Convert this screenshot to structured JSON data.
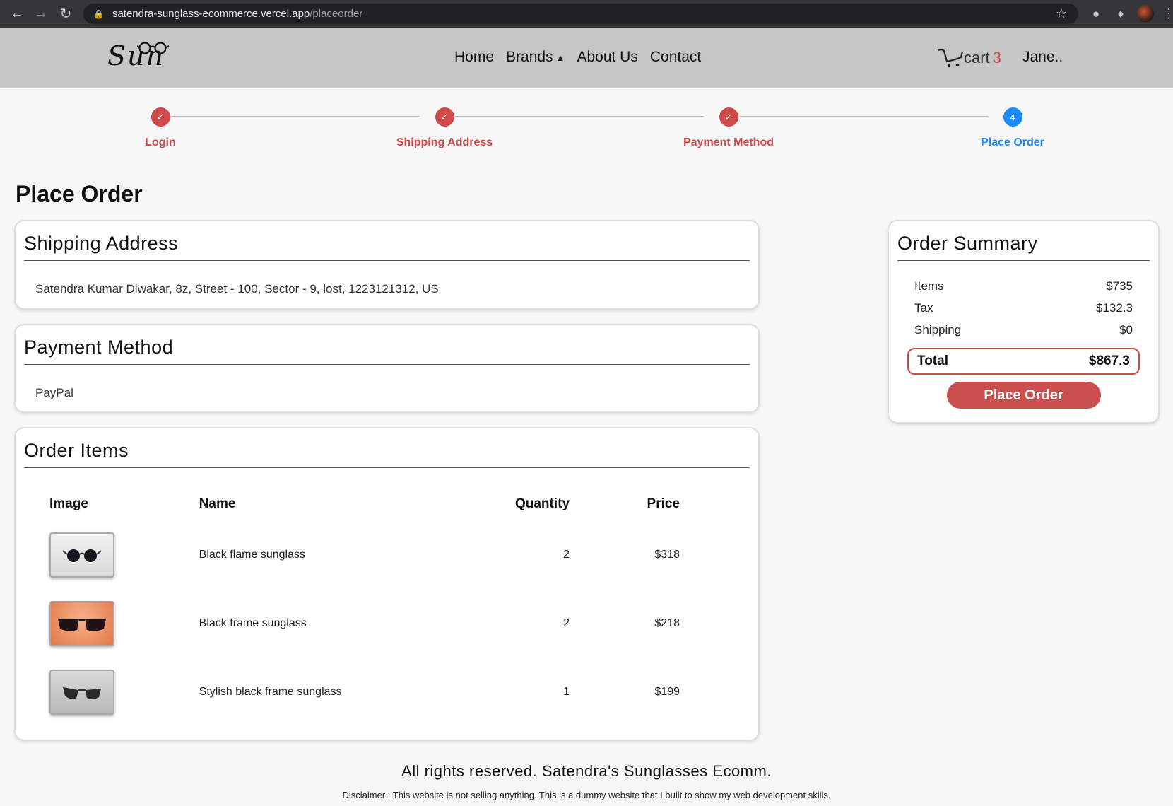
{
  "browser": {
    "url_host": "satendra-sunglass-ecommerce.vercel.app",
    "url_path": "/placeorder"
  },
  "header": {
    "logo": "Sun",
    "nav": [
      "Home",
      "Brands",
      "About Us",
      "Contact"
    ],
    "cart_label": "cart",
    "cart_count": "3",
    "user": "Jane.."
  },
  "steps": [
    {
      "label": "Login",
      "state": "done"
    },
    {
      "label": "Shipping Address",
      "state": "done"
    },
    {
      "label": "Payment Method",
      "state": "done"
    },
    {
      "label": "Place Order",
      "state": "active",
      "number": "4"
    }
  ],
  "page_title": "Place Order",
  "shipping": {
    "title": "Shipping Address",
    "address": "Satendra Kumar Diwakar, 8z, Street - 100, Sector - 9, lost, 1223121312, US"
  },
  "payment": {
    "title": "Payment Method",
    "method": "PayPal"
  },
  "order_items": {
    "title": "Order Items",
    "headers": [
      "Image",
      "Name",
      "Quantity",
      "Price"
    ],
    "rows": [
      {
        "name": "Black flame sunglass",
        "quantity": "2",
        "price": "$318",
        "thumb": "round-black-sunglasses-icon"
      },
      {
        "name": "Black frame sunglass",
        "quantity": "2",
        "price": "$218",
        "thumb": "wayfarer-sunglasses-on-orange-icon"
      },
      {
        "name": "Stylish black frame sunglass",
        "quantity": "1",
        "price": "$199",
        "thumb": "clubmaster-sunglasses-icon"
      }
    ]
  },
  "summary": {
    "title": "Order Summary",
    "items_label": "Items",
    "items_value": "$735",
    "tax_label": "Tax",
    "tax_value": "$132.3",
    "shipping_label": "Shipping",
    "shipping_value": "$0",
    "total_label": "Total",
    "total_value": "$867.3",
    "button": "Place Order"
  },
  "footer": {
    "rights": "All rights reserved. Satendra's Sunglasses Ecomm.",
    "disclaimer": "Disclaimer : This website is not selling anything. This is a dummy website that I built to show my web development skills."
  },
  "colors": {
    "accent_red": "#d04a4a",
    "active_blue": "#1a8cff",
    "header_bg": "#c6c6c6"
  }
}
